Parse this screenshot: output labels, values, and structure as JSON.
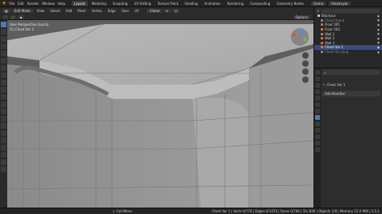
{
  "topbar": {
    "menus": [
      "File",
      "Edit",
      "Render",
      "Window",
      "Help"
    ],
    "workspaces": [
      "Layout",
      "Modeling",
      "Sculpting",
      "UV Editing",
      "Texture Paint",
      "Shading",
      "Animation",
      "Rendering",
      "Compositing",
      "Geometry Nodes"
    ],
    "active_workspace": "Layout",
    "scene_label": "Scene",
    "view_layer_label": "ViewLayer"
  },
  "viewport_header": {
    "mode": "Edit Mode",
    "menus": [
      "View",
      "Select",
      "Add",
      "Mesh",
      "Vertex",
      "Edge",
      "Face",
      "UV"
    ],
    "transform": "Global",
    "options_label": "Options"
  },
  "viewport": {
    "view_name": "User Perspective (Local)",
    "object_info": "(1) Chest Var 1"
  },
  "outliner": {
    "items": [
      {
        "label": "Blockout",
        "color": "#cfcfcf",
        "selected": false
      },
      {
        "label": "Chest Stand",
        "color": "#7f8a9a",
        "selected": false
      },
      {
        "label": "Floor 001",
        "color": "#e07b39",
        "selected": false
      },
      {
        "label": "Floor 002",
        "color": "#e07b39",
        "selected": false
      },
      {
        "label": "Wall 1",
        "color": "#e07b39",
        "selected": false
      },
      {
        "label": "Wall 2",
        "color": "#e07b39",
        "selected": false
      },
      {
        "label": "Wall 3",
        "color": "#e07b39",
        "selected": false
      },
      {
        "label": "Chest Var 1",
        "color": "#e07b39",
        "selected": true
      },
      {
        "label": "Chest Var plug",
        "color": "#7f8a9a",
        "selected": false
      }
    ]
  },
  "properties": {
    "object_name": "Chest Var 1",
    "add_modifier_label": "Add Modifier"
  },
  "status": {
    "left": "Call Menu",
    "stats": "Chest Var 1 | Verts 0/778 | Edges 0/1470 | Faces 0/706 | Tris 830 | Objects 1/8 | Memory 15.0 MiB | 3.5.1"
  },
  "colors": {
    "accent": "#5079b4",
    "viewport_bg": "#9a9a9a",
    "panel_bg": "#2b2b2b"
  }
}
